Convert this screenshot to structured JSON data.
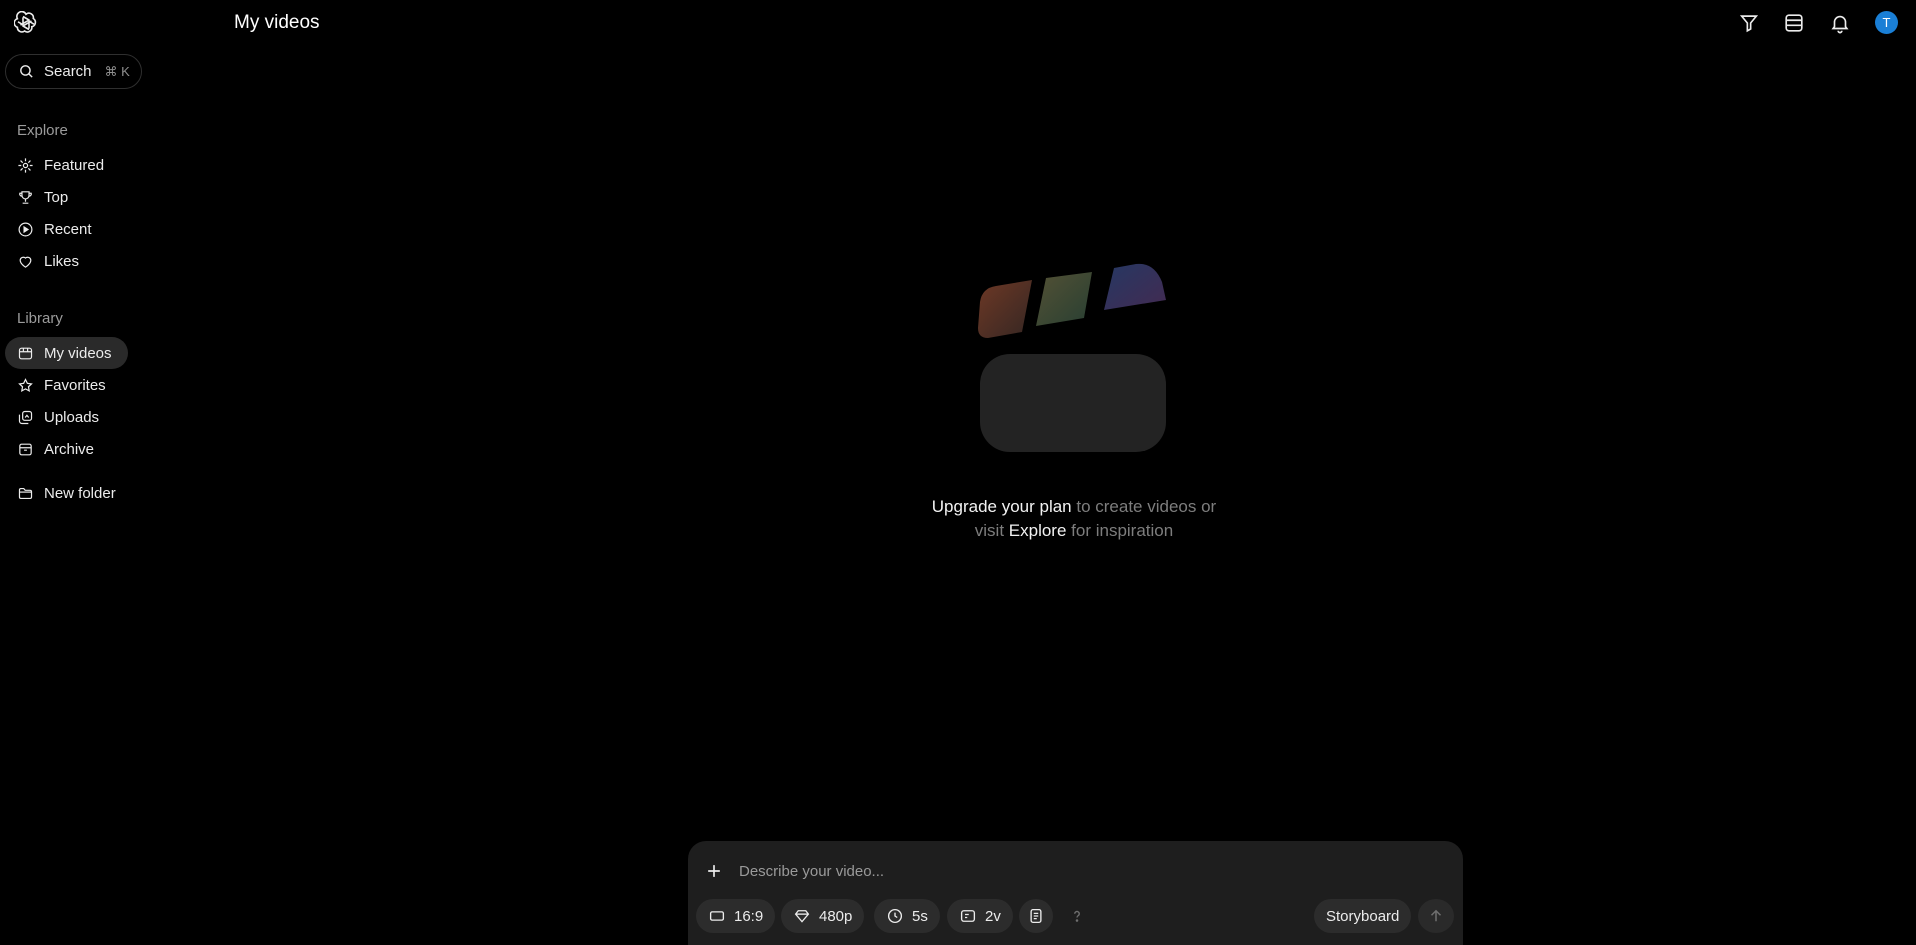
{
  "header": {
    "title": "My videos"
  },
  "search": {
    "label": "Search",
    "shortcut": "⌘ K"
  },
  "sidebar": {
    "explore_label": "Explore",
    "explore": [
      {
        "label": "Featured",
        "icon": "sparkle-icon"
      },
      {
        "label": "Top",
        "icon": "trophy-icon"
      },
      {
        "label": "Recent",
        "icon": "play-circle-icon"
      },
      {
        "label": "Likes",
        "icon": "heart-icon"
      }
    ],
    "library_label": "Library",
    "library": [
      {
        "label": "My videos",
        "icon": "calendar-grid-icon",
        "active": true
      },
      {
        "label": "Favorites",
        "icon": "star-icon"
      },
      {
        "label": "Uploads",
        "icon": "uploads-icon"
      },
      {
        "label": "Archive",
        "icon": "archive-icon"
      }
    ],
    "new_folder": "New folder"
  },
  "topbar": {
    "icons": [
      "filter-icon",
      "layout-icon",
      "bell-icon"
    ],
    "avatar_initial": "T",
    "avatar_color": "#1a7fd6"
  },
  "empty_state": {
    "line1_strong": "Upgrade your plan",
    "line1_rest": " to create videos or",
    "line2_pre": "visit ",
    "line2_strong": "Explore",
    "line2_rest": " for inspiration"
  },
  "composer": {
    "placeholder": "Describe your video...",
    "aspect": "16:9",
    "resolution": "480p",
    "duration": "5s",
    "variations": "2v",
    "storyboard": "Storyboard"
  },
  "colors": {
    "background": "#000000",
    "composer_bg": "#1e1e1e",
    "chip_bg": "#2c2c2c"
  }
}
